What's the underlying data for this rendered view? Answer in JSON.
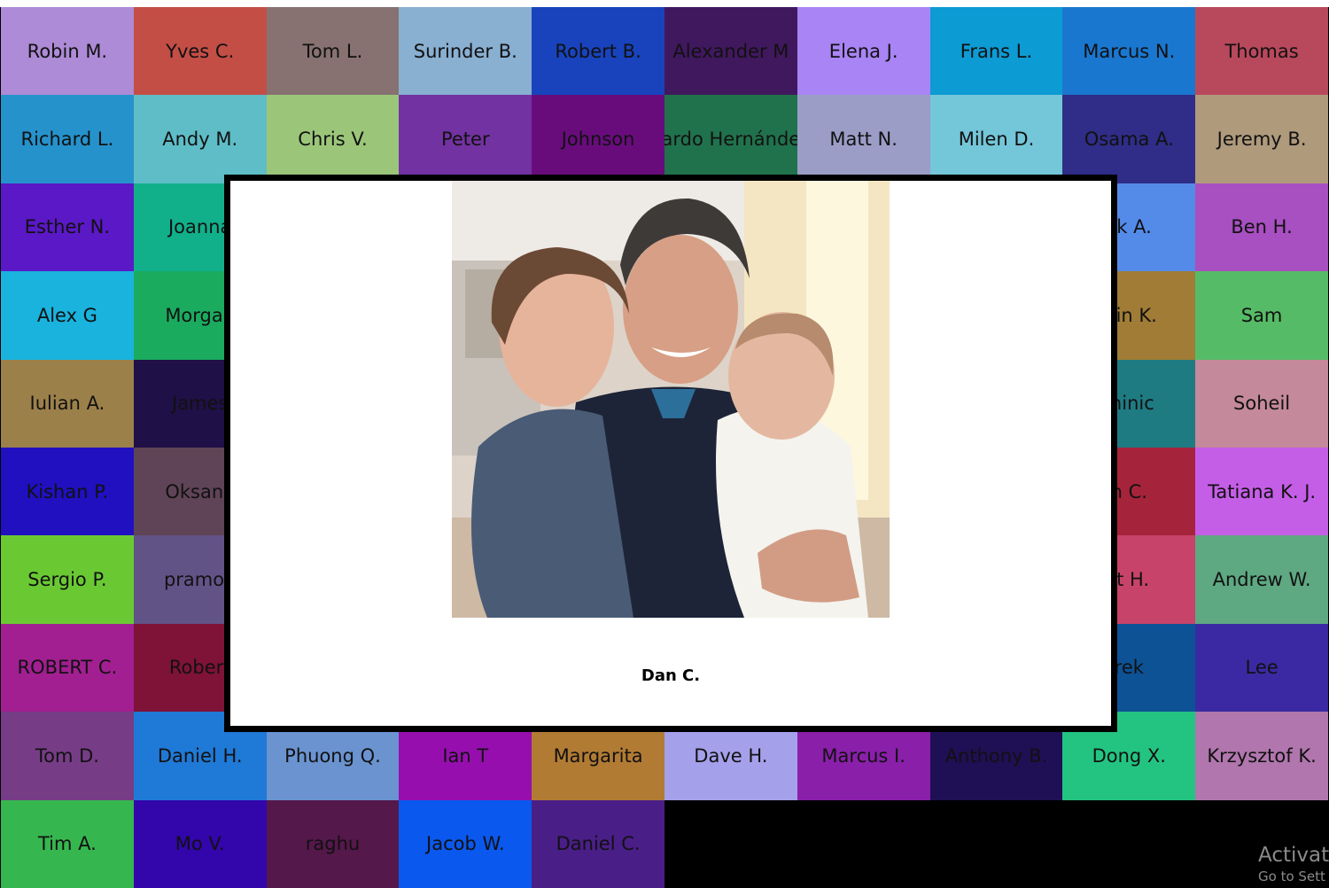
{
  "tiles": [
    {
      "name": "Robin M.",
      "color": "#ad8bd6"
    },
    {
      "name": "Yves C.",
      "color": "#c34e46"
    },
    {
      "name": "Tom L.",
      "color": "#877171"
    },
    {
      "name": "Surinder B.",
      "color": "#89afd1"
    },
    {
      "name": "Robert B.",
      "color": "#1843bd"
    },
    {
      "name": "Alexander M",
      "color": "#40185e"
    },
    {
      "name": "Elena J.",
      "color": "#a984f5"
    },
    {
      "name": "Frans L.",
      "color": "#0c9bd3"
    },
    {
      "name": "Marcus N.",
      "color": "#1a77cf"
    },
    {
      "name": "Thomas",
      "color": "#b8485c"
    },
    {
      "name": "Richard L.",
      "color": "#2592cc"
    },
    {
      "name": "Andy M.",
      "color": "#5ebdc6"
    },
    {
      "name": "Chris V.",
      "color": "#9bc67a"
    },
    {
      "name": "Peter",
      "color": "#7232a1"
    },
    {
      "name": "Johnson",
      "color": "#680c7c"
    },
    {
      "name": "ardo Hernánde",
      "color": "#20724c"
    },
    {
      "name": "Matt N.",
      "color": "#9c9dc7"
    },
    {
      "name": "Milen D.",
      "color": "#74c6d9"
    },
    {
      "name": "Osama A.",
      "color": "#2f2d87"
    },
    {
      "name": "Jeremy B.",
      "color": "#b09a7c"
    },
    {
      "name": "Esther N.",
      "color": "#5a18c6"
    },
    {
      "name": "Joanna",
      "color": "#11b08b"
    },
    {
      "name": "",
      "color": "#ffffff"
    },
    {
      "name": "",
      "color": "#ffffff"
    },
    {
      "name": "",
      "color": "#ffffff"
    },
    {
      "name": "",
      "color": "#ffffff"
    },
    {
      "name": "",
      "color": "#ffffff"
    },
    {
      "name": "",
      "color": "#ffffff"
    },
    {
      "name": "ck A.",
      "color": "#548be9"
    },
    {
      "name": "Ben H.",
      "color": "#a84fc1"
    },
    {
      "name": "Alex G",
      "color": "#19b3de"
    },
    {
      "name": "Morgan",
      "color": "#1bab5f"
    },
    {
      "name": "",
      "color": "#ffffff"
    },
    {
      "name": "",
      "color": "#ffffff"
    },
    {
      "name": "",
      "color": "#ffffff"
    },
    {
      "name": "",
      "color": "#ffffff"
    },
    {
      "name": "",
      "color": "#ffffff"
    },
    {
      "name": "",
      "color": "#ffffff"
    },
    {
      "name": "rtin K.",
      "color": "#a07c36"
    },
    {
      "name": "Sam",
      "color": "#56bb66"
    },
    {
      "name": "Iulian A.",
      "color": "#9c804a"
    },
    {
      "name": "James",
      "color": "#1f1047"
    },
    {
      "name": "",
      "color": "#ffffff"
    },
    {
      "name": "",
      "color": "#ffffff"
    },
    {
      "name": "",
      "color": "#ffffff"
    },
    {
      "name": "",
      "color": "#ffffff"
    },
    {
      "name": "",
      "color": "#ffffff"
    },
    {
      "name": "",
      "color": "#ffffff"
    },
    {
      "name": "minic",
      "color": "#1f7b82"
    },
    {
      "name": "Soheil",
      "color": "#c4899b"
    },
    {
      "name": "Kishan P.",
      "color": "#2010c0"
    },
    {
      "name": "Oksana",
      "color": "#5e4456"
    },
    {
      "name": "",
      "color": "#ffffff"
    },
    {
      "name": "",
      "color": "#ffffff"
    },
    {
      "name": "",
      "color": "#ffffff"
    },
    {
      "name": "",
      "color": "#ffffff"
    },
    {
      "name": "",
      "color": "#ffffff"
    },
    {
      "name": "",
      "color": "#ffffff"
    },
    {
      "name": "n C.",
      "color": "#a6243b"
    },
    {
      "name": "Tatiana K.  J.",
      "color": "#c55ee7"
    },
    {
      "name": "Sergio P.",
      "color": "#6ac933"
    },
    {
      "name": "pramod",
      "color": "#625387"
    },
    {
      "name": "",
      "color": "#ffffff"
    },
    {
      "name": "",
      "color": "#ffffff"
    },
    {
      "name": "",
      "color": "#ffffff"
    },
    {
      "name": "",
      "color": "#ffffff"
    },
    {
      "name": "",
      "color": "#ffffff"
    },
    {
      "name": "",
      "color": "#ffffff"
    },
    {
      "name": "rt H.",
      "color": "#c84369"
    },
    {
      "name": "Andrew W.",
      "color": "#5ea882"
    },
    {
      "name": "ROBERT C.",
      "color": "#a21f91"
    },
    {
      "name": "Robert",
      "color": "#7f1237"
    },
    {
      "name": "",
      "color": "#ffffff"
    },
    {
      "name": "",
      "color": "#ffffff"
    },
    {
      "name": "",
      "color": "#ffffff"
    },
    {
      "name": "",
      "color": "#ffffff"
    },
    {
      "name": "",
      "color": "#ffffff"
    },
    {
      "name": "",
      "color": "#ffffff"
    },
    {
      "name": "rek",
      "color": "#0d5295"
    },
    {
      "name": "Lee",
      "color": "#3a29a2"
    },
    {
      "name": "Tom D.",
      "color": "#763d86"
    },
    {
      "name": "Daniel H.",
      "color": "#1f79d6"
    },
    {
      "name": "Phuong Q.",
      "color": "#6a93d0"
    },
    {
      "name": "Ian T",
      "color": "#960fae"
    },
    {
      "name": "Margarita",
      "color": "#b27b34"
    },
    {
      "name": "Dave H.",
      "color": "#a5a0ea"
    },
    {
      "name": "Marcus I.",
      "color": "#8a1faa"
    },
    {
      "name": "Anthony B.",
      "color": "#1f0f55"
    },
    {
      "name": "Dong X.",
      "color": "#23c481"
    },
    {
      "name": "Krzysztof K.",
      "color": "#b176ad"
    },
    {
      "name": "Tim A.",
      "color": "#36b64f"
    },
    {
      "name": "Mo V.",
      "color": "#3206ab"
    },
    {
      "name": "raghu",
      "color": "#55184b"
    },
    {
      "name": "Jacob W.",
      "color": "#0a58ed"
    },
    {
      "name": "Daniel C.",
      "color": "#4a1e87"
    }
  ],
  "popup": {
    "caption": "Dan C."
  },
  "watermark": {
    "line1": "Activate",
    "line2": "Go to Sett"
  }
}
